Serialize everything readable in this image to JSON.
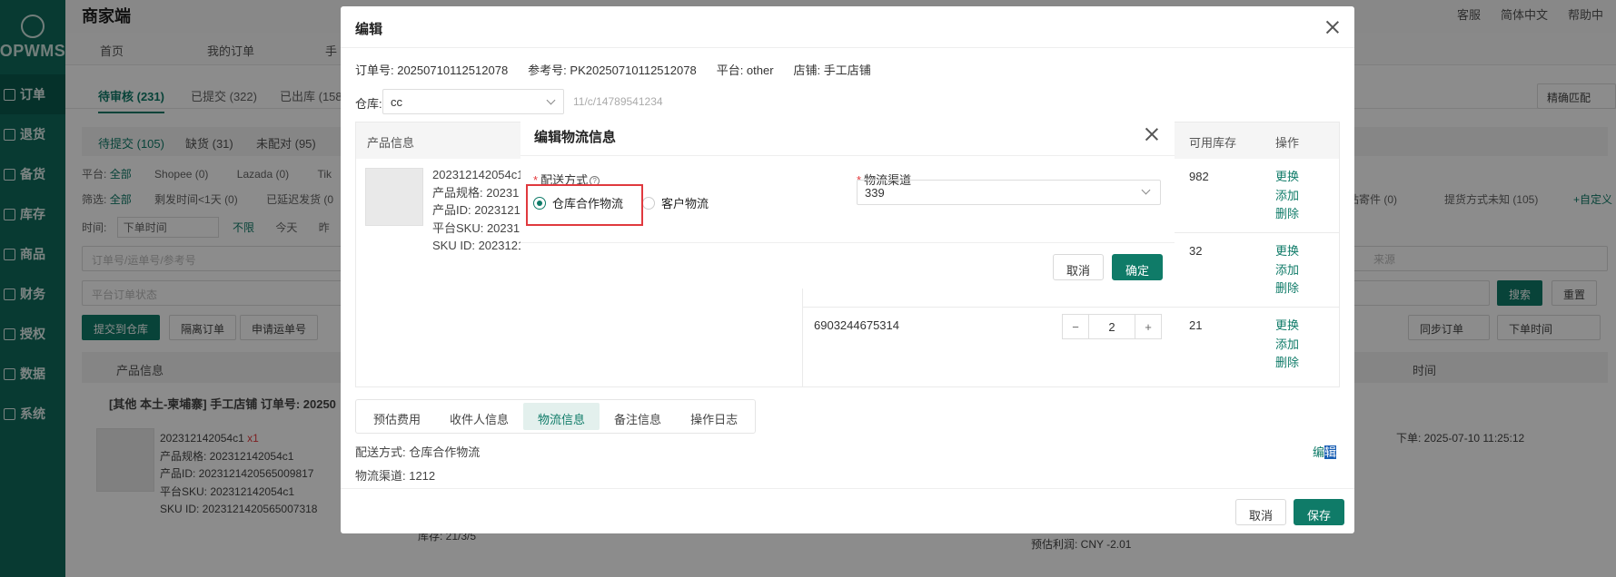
{
  "sidebar": {
    "logo": "OPWMS",
    "items": [
      {
        "label": "订单",
        "icon": "list-icon"
      },
      {
        "label": "退货",
        "icon": "return-icon"
      },
      {
        "label": "备货",
        "icon": "box-icon"
      },
      {
        "label": "库存",
        "icon": "warehouse-icon"
      },
      {
        "label": "商品",
        "icon": "shop-icon"
      },
      {
        "label": "财务",
        "icon": "finance-icon"
      },
      {
        "label": "授权",
        "icon": "shield-icon"
      },
      {
        "label": "数据",
        "icon": "chart-icon"
      },
      {
        "label": "系统",
        "icon": "gear-icon"
      }
    ]
  },
  "header": {
    "title": "商家端",
    "links": [
      "客服",
      "简体中文",
      "帮助中"
    ]
  },
  "top_tabs": [
    "首页",
    "我的订单",
    "手"
  ],
  "status_tabs": [
    "待审核 (231)",
    "已提交 (322)",
    "已出库 (158"
  ],
  "sub_tabs": [
    "待提交 (105)",
    "缺货 (31)",
    "未配对 (95)"
  ],
  "filters": {
    "platform_label": "平台:",
    "platform_all": "全部",
    "platforms": [
      "Shopee (0)",
      "Lazada (0)",
      "Tik"
    ],
    "screen_label": "筛选:",
    "screen_all": "全部",
    "screens": [
      "剩发时间<1天 (0)",
      "已延迟发货 (0"
    ],
    "time_label": "时间:",
    "time_select": "下单时间",
    "time_opts": [
      "不限",
      "今天",
      "昨"
    ],
    "right_a": "站寄件 (0)",
    "right_b": "提货方式未知 (105)",
    "right_c": "+自定义",
    "precise": "精确匹配"
  },
  "search": {
    "order_placeholder": "订单号/运单号/参考号",
    "status_placeholder": "平台订单状态",
    "source_placeholder": "来源",
    "search_btn": "搜索",
    "reset_btn": "重置"
  },
  "toolbar": {
    "submit": "提交到仓库",
    "isolate": "隔离订单",
    "apply_waybill": "申请运单号",
    "sync": "同步订单",
    "sort": "下单时间"
  },
  "list_head": {
    "product": "产品信息",
    "time": "时间"
  },
  "order_group": {
    "title": "[其他 本土-柬埔寨] 手工店铺 订单号: 20250",
    "sku": "202312142054c1",
    "qty": "x1",
    "spec": "产品规格: 202312142054c1",
    "pid": "产品ID: 2023121420565009817",
    "psku": "平台SKU: 202312142054c1",
    "skuid": "SKU ID: 2023121420565007318",
    "stock": "库存: 21/3/5",
    "profit": "预估利润: CNY -2.01",
    "placed": "下单: 2025-07-10 11:25:12"
  },
  "edit_modal": {
    "title": "编辑",
    "order_no": "订单号: 20250710112512078",
    "ref_no": "参考号: PK20250710112512078",
    "platform": "平台: other",
    "store": "店铺: 手工店铺",
    "warehouse_label": "仓库:",
    "warehouse_value": "cc",
    "warehouse_extra": "11/c/14789541234",
    "table_head": {
      "product": "产品信息",
      "stock": "可用库存",
      "ops": "操作"
    },
    "product": {
      "sku": "202312142054c1",
      "spec": "产品规格: 20231",
      "pid": "产品ID: 2023121",
      "psku": "平台SKU: 20231",
      "skuid": "SKU ID: 2023121"
    },
    "rows": [
      {
        "ean": "",
        "stock": "982"
      },
      {
        "ean": "",
        "stock": "32"
      },
      {
        "ean": "6903244675314",
        "stock": "21",
        "qty": "2"
      }
    ],
    "row_ops": [
      "更换",
      "添加",
      "删除"
    ],
    "tabs": [
      "预估费用",
      "收件人信息",
      "物流信息",
      "备注信息",
      "操作日志"
    ],
    "ship_method": "配送方式: 仓库合作物流",
    "ship_channel": "物流渠道: 1212",
    "edit_link_a": "编",
    "edit_link_b": "辑",
    "cancel": "取消",
    "save": "保存"
  },
  "ship_modal": {
    "title": "编辑物流信息",
    "method_label": "配送方式",
    "method_help": "?",
    "options": [
      "仓库合作物流",
      "客户物流"
    ],
    "selected": 0,
    "channel_label": "物流渠道",
    "channel_value": "339",
    "cancel": "取消",
    "confirm": "确定"
  },
  "colors": {
    "brand": "#0f7b68",
    "sidebar": "#0f6b5c",
    "highlight": "#e0393e"
  }
}
